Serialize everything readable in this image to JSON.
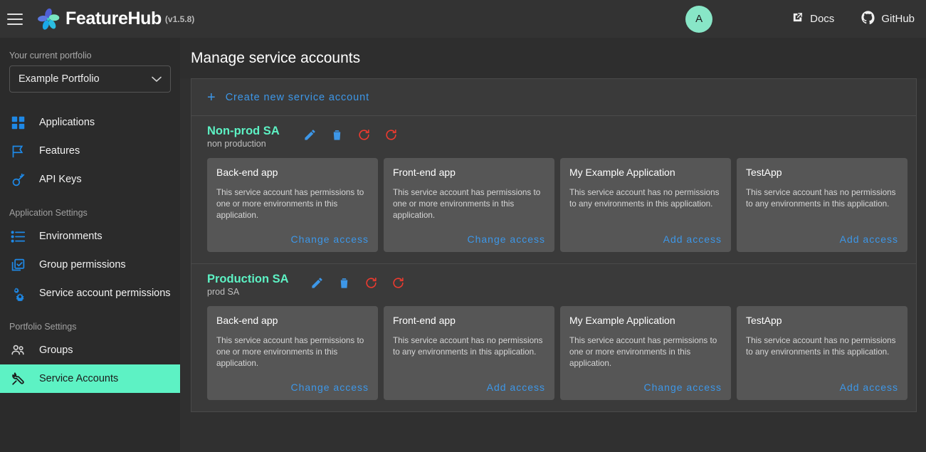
{
  "topbar": {
    "menu_icon": "hamburger-icon",
    "brand": "FeatureHub",
    "version": "(v1.5.8)",
    "avatar_initial": "A",
    "links": [
      {
        "label": "Docs",
        "icon": "external-link-icon"
      },
      {
        "label": "GitHub",
        "icon": "github-icon"
      }
    ]
  },
  "sidebar": {
    "portfolio_label": "Your current portfolio",
    "portfolio_value": "Example Portfolio",
    "items": [
      {
        "label": "Applications",
        "icon": "grid-icon",
        "active": false
      },
      {
        "label": "Features",
        "icon": "flag-icon",
        "active": false
      },
      {
        "label": "API Keys",
        "icon": "key-icon",
        "active": false
      }
    ],
    "section_application": "Application Settings",
    "application_items": [
      {
        "label": "Environments",
        "icon": "list-icon",
        "active": false
      },
      {
        "label": "Group permissions",
        "icon": "checkbox-stack-icon",
        "active": false
      },
      {
        "label": "Service account permissions",
        "icon": "gears-icon",
        "active": false
      }
    ],
    "section_portfolio": "Portfolio Settings",
    "portfolio_items": [
      {
        "label": "Groups",
        "icon": "people-icon",
        "active": false
      },
      {
        "label": "Service Accounts",
        "icon": "wrench-icon",
        "active": true
      }
    ]
  },
  "main": {
    "title": "Manage service accounts",
    "create_label": "Create new service account",
    "service_accounts": [
      {
        "name": "Non-prod SA",
        "description": "non production",
        "actions": [
          {
            "name": "edit-icon",
            "color": "#3d97e8"
          },
          {
            "name": "delete-icon",
            "color": "#3d97e8"
          },
          {
            "name": "reset-icon",
            "color": "#f03a2f"
          },
          {
            "name": "reset-all-icon",
            "color": "#f03a2f"
          }
        ],
        "cards": [
          {
            "title": "Back-end app",
            "body": "This service account has permissions to one or more environments in this application.",
            "action": "Change access"
          },
          {
            "title": "Front-end app",
            "body": "This service account has permissions to one or more environments in this application.",
            "action": "Change access"
          },
          {
            "title": "My Example Application",
            "body": "This service account has no permissions to any environments in this application.",
            "action": "Add access"
          },
          {
            "title": "TestApp",
            "body": "This service account has no permissions to any environments in this application.",
            "action": "Add access"
          }
        ]
      },
      {
        "name": "Production SA",
        "description": "prod SA",
        "actions": [
          {
            "name": "edit-icon",
            "color": "#3d97e8"
          },
          {
            "name": "delete-icon",
            "color": "#3d97e8"
          },
          {
            "name": "reset-icon",
            "color": "#f03a2f"
          },
          {
            "name": "reset-all-icon",
            "color": "#f03a2f"
          }
        ],
        "cards": [
          {
            "title": "Back-end app",
            "body": "This service account has permissions to one or more environments in this application.",
            "action": "Change access"
          },
          {
            "title": "Front-end app",
            "body": "This service account has no permissions to any environments in this application.",
            "action": "Add access"
          },
          {
            "title": "My Example Application",
            "body": "This service account has permissions to one or more environments in this application.",
            "action": "Change access"
          },
          {
            "title": "TestApp",
            "body": "This service account has no permissions to any environments in this application.",
            "action": "Add access"
          }
        ]
      }
    ]
  },
  "colors": {
    "accent_blue": "#3d97e8",
    "accent_mint": "#5df2c4",
    "danger_red": "#f03a2f",
    "bg": "#303030"
  }
}
